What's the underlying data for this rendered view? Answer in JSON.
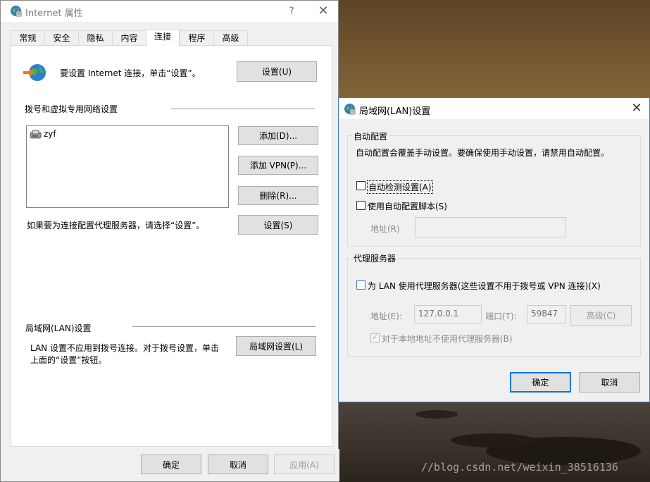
{
  "watermark": "//blog.csdn.net/weixin_38516136",
  "internet_props": {
    "title": "Internet 属性",
    "help_glyph": "?",
    "close_glyph": "✕",
    "tabs": [
      {
        "label": "常规"
      },
      {
        "label": "安全"
      },
      {
        "label": "隐私"
      },
      {
        "label": "内容"
      },
      {
        "label": "连接"
      },
      {
        "label": "程序"
      },
      {
        "label": "高级"
      }
    ],
    "active_tab": "连接",
    "setup_text": "要设置 Internet 连接，单击“设置”。",
    "setup_button": "设置(U)",
    "dialup_section_title": "拨号和虚拟专用网络设置",
    "connections": [
      {
        "name": "zyf",
        "icon": "dialup-connection-icon"
      }
    ],
    "add_button": "添加(D)...",
    "add_vpn_button": "添加 VPN(P)...",
    "remove_button": "删除(R)...",
    "proxy_text": "如果要为连接配置代理服务器，请选择“设置”。",
    "settings_button": "设置(S)",
    "lan_section_title": "局域网(LAN)设置",
    "lan_text_line1": "LAN 设置不应用到拨号连接。对于拨号设置，单击",
    "lan_text_line2": "上面的“设置”按钮。",
    "lan_settings_button": "局域网设置(L)",
    "ok_button": "确定",
    "cancel_button": "取消",
    "apply_button": "应用(A)"
  },
  "lan_dialog": {
    "title": "局域网(LAN)设置",
    "close_glyph": "✕",
    "auto_config": {
      "group_title": "自动配置",
      "description": "自动配置会覆盖手动设置。要确保使用手动设置，请禁用自动配置。",
      "auto_detect_label": "自动检测设置(A)",
      "auto_detect_checked": false,
      "use_script_label": "使用自动配置脚本(S)",
      "use_script_checked": false,
      "address_label": "地址(R)",
      "address_value": ""
    },
    "proxy": {
      "group_title": "代理服务器",
      "use_proxy_label": "为 LAN 使用代理服务器(这些设置不用于拨号或 VPN 连接)(X)",
      "use_proxy_checked": false,
      "address_label": "地址(E):",
      "address_value": "127.0.0.1",
      "port_label": "端口(T):",
      "port_value": "59847",
      "advanced_button": "高级(C)",
      "bypass_local_label": "对于本地地址不使用代理服务器(B)",
      "bypass_local_checked": true
    },
    "ok_button": "确定",
    "cancel_button": "取消"
  }
}
